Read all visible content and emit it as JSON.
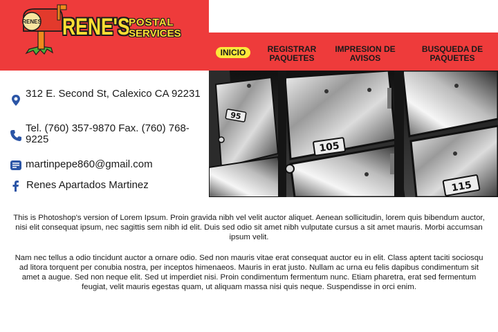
{
  "brand": {
    "name": "RENE'S",
    "line1": "POSTAL",
    "line2": "SERVICES",
    "mailbox_text": "RENES",
    "accent_red": "#ee3b3b",
    "accent_yellow": "#fde93a"
  },
  "nav": {
    "items": [
      {
        "label": "INICIO",
        "active": true
      },
      {
        "label": "REGISTRAR PAQUETES"
      },
      {
        "label": "IMPRESION DE AVISOS"
      },
      {
        "label": "BUSQUEDA DE PAQUETES"
      }
    ]
  },
  "photo": {
    "box_numbers": [
      "95",
      "105",
      "115"
    ]
  },
  "contact": {
    "address": "312 E. Second St, Calexico CA 92231",
    "phone": "Tel. (760) 357-9870  Fax. (760) 768-9225",
    "email": "martinpepe860@gmail.com",
    "facebook": "Renes Apartados Martinez",
    "icon_color": "#2b55a6"
  },
  "body": {
    "paragraph1": "This is Photoshop's version  of Lorem Ipsum. Proin gravida nibh vel velit auctor aliquet. Aenean sollicitudin, lorem quis bibendum auctor, nisi elit consequat ipsum, nec sagittis sem nibh id elit. Duis sed odio sit amet nibh vulputate cursus a sit amet mauris. Morbi accumsan ipsum velit.",
    "paragraph2": "Nam nec tellus a odio tincidunt auctor a ornare odio. Sed non  mauris vitae erat consequat auctor eu in elit. Class aptent taciti sociosqu ad litora torquent per conubia nostra, per inceptos himenaeos. Mauris in erat justo. Nullam ac urna eu felis dapibus condimentum sit amet a augue. Sed non neque elit. Sed ut imperdiet nisi. Proin condimentum fermentum nunc. Etiam pharetra, erat sed fermentum feugiat, velit mauris egestas quam, ut aliquam massa nisi quis neque. Suspendisse in orci enim."
  }
}
